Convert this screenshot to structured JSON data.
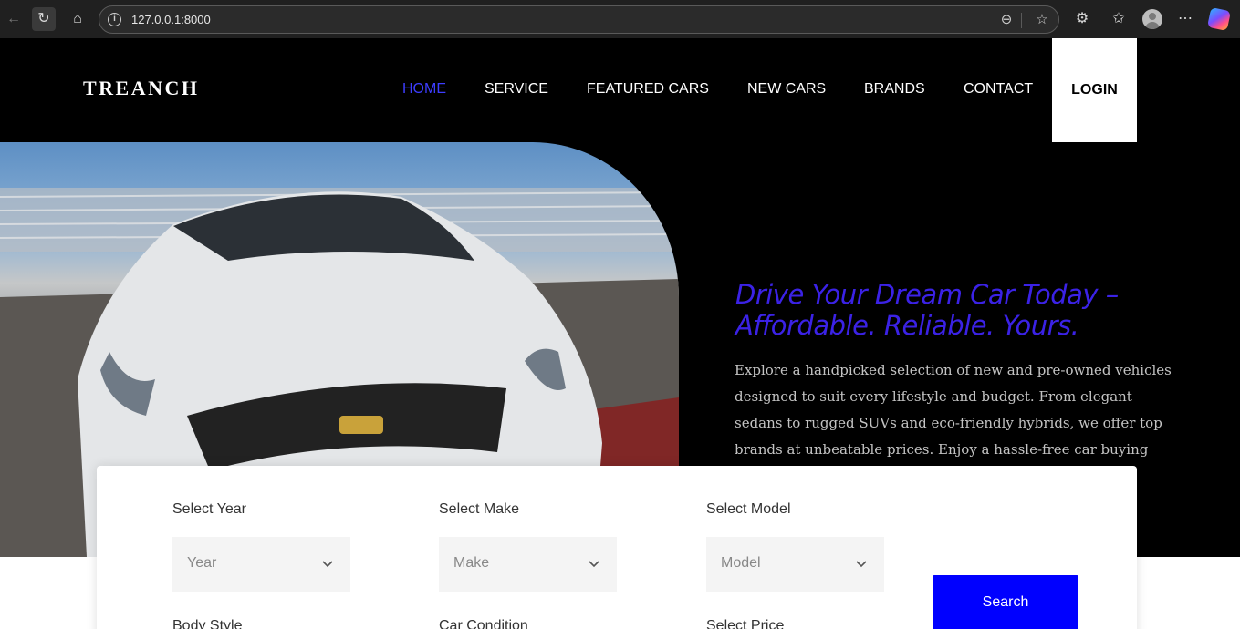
{
  "browser": {
    "url": "127.0.0.1:8000"
  },
  "nav": {
    "logo": "TREANCH",
    "items": [
      "HOME",
      "SERVICE",
      "FEATURED CARS",
      "NEW CARS",
      "BRANDS",
      "CONTACT"
    ],
    "active": "HOME",
    "login": "LOGIN"
  },
  "hero": {
    "title": "Drive Your Dream Car Today – Affordable. Reliable. Yours.",
    "text": "Explore a handpicked selection of new and pre-owned vehicles designed to suit every lifestyle and budget. From elegant sedans to rugged SUVs and eco-friendly hybrids, we offer top brands at unbeatable prices. Enjoy a hassle-free car buying experience with flexible financing, expert advice, and exceptional customer support."
  },
  "search": {
    "year_label": "Select Year",
    "year_value": "Year",
    "make_label": "Select Make",
    "make_value": "Make",
    "model_label": "Select Model",
    "model_value": "Model",
    "body_label": "Body Style",
    "condition_label": "Car Condition",
    "price_label": "Select Price",
    "button": "Search"
  },
  "colors": {
    "accent": "#3d3dff",
    "button": "#0000ff",
    "title": "#3b22e6"
  }
}
